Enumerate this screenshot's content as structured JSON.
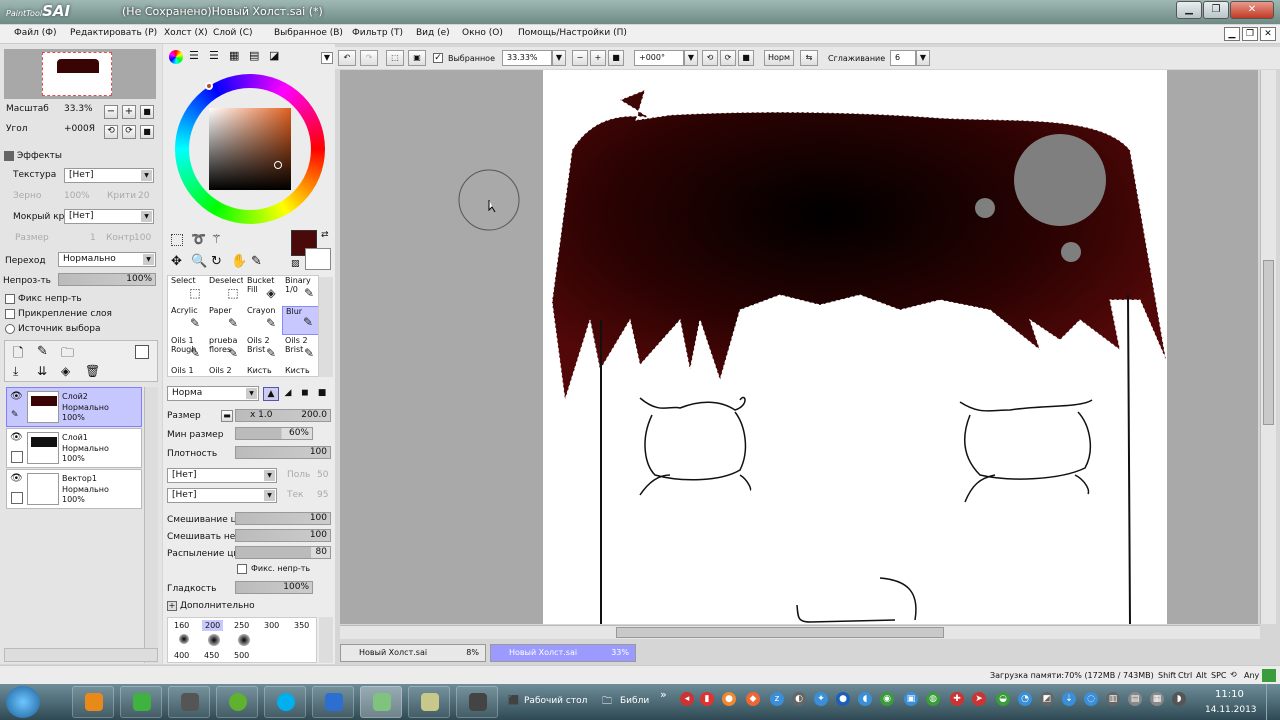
{
  "app": {
    "name": "PaintTool",
    "name_big": "SAI",
    "window_title": "(Не Сохранено)Новый Холст.sai (*)"
  },
  "menu": [
    "Файл (Ф)",
    "Редактировать (Р)",
    "Холст (Х)",
    "Слой (С)",
    "Выбранное (В)",
    "Фильтр (Т)",
    "Вид (е)",
    "Окно (О)",
    "Помощь/Настройки (П)"
  ],
  "toolbar": {
    "selected_label": "Выбранное",
    "zoom": "33.33%",
    "angle": "+000°",
    "mode": "Норм",
    "smoothing_label": "Сглаживание",
    "smoothing": "6"
  },
  "navigator": {
    "scale_label": "Масштаб",
    "scale_value": "33.3%",
    "angle_label": "Угол",
    "angle_value": "+000Я"
  },
  "effects": {
    "title": "Эффекты",
    "texture_label": "Текстура",
    "texture_value": "[Нет]",
    "grain_label": "Зерно",
    "grain_value": "100%",
    "edge_label": "Крити",
    "edge_value": "20",
    "wet_label": "Мокрый край",
    "wet_value": "[Нет]",
    "size_label": "Размер",
    "size_value": "1",
    "contrast_label": "Контр",
    "contrast_value": "100"
  },
  "layer_props": {
    "blend_label": "Переход",
    "blend_value": "Нормально",
    "opacity_label": "Непроз-ть",
    "opacity_value": "100%",
    "fix_opacity": "Фикс непр-ть",
    "clip": "Прикрепление слоя",
    "source": "Источник выбора"
  },
  "layers": [
    {
      "name": "Слой2",
      "mode": "Нормально",
      "opacity": "100%"
    },
    {
      "name": "Слой1",
      "mode": "Нормально",
      "opacity": "100%"
    },
    {
      "name": "Вектор1",
      "mode": "Нормально",
      "opacity": "100%"
    }
  ],
  "tools": [
    {
      "name": "Select",
      "extra": ""
    },
    {
      "name": "Deselect",
      "extra": ""
    },
    {
      "name": "Bucket",
      "extra": "Fill"
    },
    {
      "name": "Binary",
      "extra": "1/0"
    },
    {
      "name": "Acrylic",
      "extra": ""
    },
    {
      "name": "Paper",
      "extra": ""
    },
    {
      "name": "Crayon",
      "extra": ""
    },
    {
      "name": "Blur",
      "extra": ""
    },
    {
      "name": "Oils 1",
      "extra": "Rough"
    },
    {
      "name": "prueba",
      "extra": "flores"
    },
    {
      "name": "Oils 2",
      "extra": "Brist"
    },
    {
      "name": "Oils 2",
      "extra": "Brist"
    },
    {
      "name": "Oils 1",
      "extra": ""
    },
    {
      "name": "Oils 2",
      "extra": ""
    },
    {
      "name": "Кисть",
      "extra": ""
    },
    {
      "name": "Кисть",
      "extra": ""
    }
  ],
  "brush": {
    "mode": "Норма",
    "size_label": "Размер",
    "size_mult": "x 1.0",
    "size_value": "200.0",
    "minsize_label": "Мин размер",
    "minsize_value": "60%",
    "density_label": "Плотность",
    "density_value": "100",
    "shape1": "[Нет]",
    "shape1_val_label": "Поль",
    "shape1_val": "50",
    "shape2": "[Нет]",
    "shape2_val_label": "Тек",
    "shape2_val": "95",
    "blend_label": "Смешивание цве",
    "blend_value": "100",
    "dilution_label": "Смешивать непр",
    "dilution_value": "100",
    "persist_label": "Распыление цвет",
    "persist_value": "80",
    "keep_opacity": "Фикс. непр-ть",
    "smooth_label": "Гладкость",
    "smooth_value": "100%",
    "advanced": "Дополнительно",
    "presets": [
      "160",
      "200",
      "250",
      "300",
      "350"
    ],
    "presets2": [
      "400",
      "450",
      "500"
    ]
  },
  "colors": {
    "primary": "#4a0a0a",
    "hair": "#3a0404",
    "wheel_marker": "#b14c3c"
  },
  "docs": [
    {
      "name": "Новый Холст.sai",
      "zoom": "8%"
    },
    {
      "name": "Новый Холст.sai",
      "zoom": "33%"
    }
  ],
  "status": {
    "memory": "Загрузка памяти:70% (172MB / 743MB)",
    "keys": [
      "Shift",
      "Ctrl",
      "Alt",
      "SPC"
    ],
    "any": "Any"
  },
  "taskbar": {
    "desktop_label": "Рабочий стол",
    "library_label": "Библи",
    "more": "»",
    "time": "11:10",
    "date": "14.11.2013"
  }
}
